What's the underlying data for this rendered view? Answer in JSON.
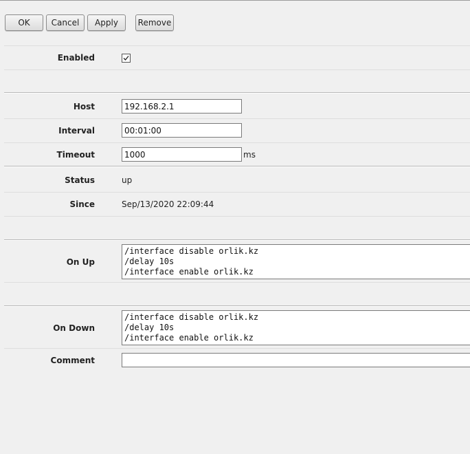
{
  "toolbar": {
    "ok_label": "OK",
    "cancel_label": "Cancel",
    "apply_label": "Apply",
    "remove_label": "Remove"
  },
  "form": {
    "enabled": {
      "label": "Enabled",
      "checked": true,
      "icon": "check-icon"
    },
    "host": {
      "label": "Host",
      "value": "192.168.2.1"
    },
    "interval": {
      "label": "Interval",
      "value": "00:01:00"
    },
    "timeout": {
      "label": "Timeout",
      "value": "1000",
      "unit": "ms"
    },
    "status": {
      "label": "Status",
      "value": "up"
    },
    "since": {
      "label": "Since",
      "value": "Sep/13/2020 22:09:44"
    },
    "on_up": {
      "label": "On Up",
      "value": "/interface disable orlik.kz\n/delay 10s\n/interface enable orlik.kz"
    },
    "on_down": {
      "label": "On Down",
      "value": "/interface disable orlik.kz\n/delay 10s\n/interface enable orlik.kz"
    },
    "comment": {
      "label": "Comment",
      "value": ""
    }
  }
}
